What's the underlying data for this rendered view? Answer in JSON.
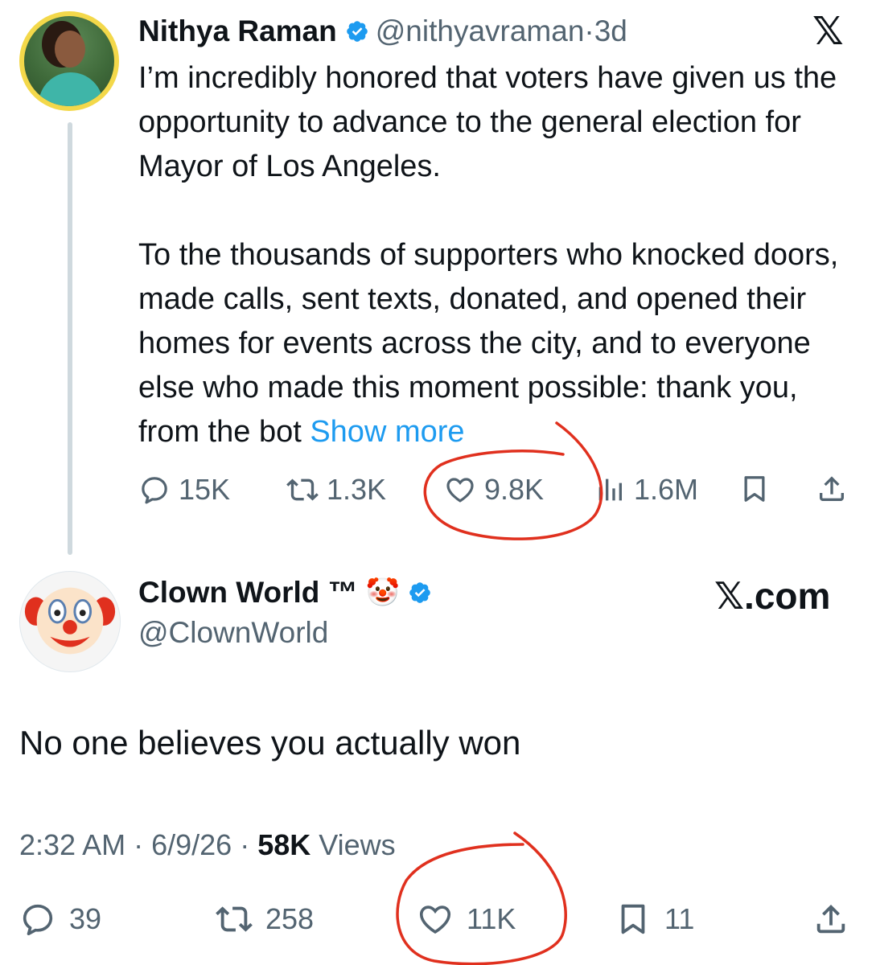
{
  "tweet1": {
    "name": "Nithya Raman",
    "handle": "@nithyavraman",
    "separator": " · ",
    "time": "3d",
    "platform_logo": "𝕏",
    "body": "I’m incredibly honored that voters have given us the opportunity to advance to the general election for Mayor of Los Angeles.\n\nTo the thousands of supporters who knocked doors, made calls, sent texts, donated, and opened their homes for events across the city, and to everyone else who made this moment possible: thank you, from the bot ",
    "show_more": "Show more",
    "replies": "15K",
    "reposts": "1.3K",
    "likes": "9.8K",
    "views": "1.6M"
  },
  "tweet2": {
    "name": "Clown World ™",
    "name_emoji": "🤡",
    "handle": "@ClownWorld",
    "site": "𝕏.com",
    "body": "No one believes you actually won",
    "time": "2:32 AM",
    "date": "6/9/26",
    "views_count": "58K",
    "views_label": "Views",
    "replies": "39",
    "reposts": "258",
    "likes": "11K",
    "bookmarks": "11"
  },
  "colors": {
    "text": "#0f1419",
    "secondary": "#536471",
    "link": "#1d9bf0",
    "verified": "#1d9bf0",
    "annotation": "#e0301e"
  },
  "icons": [
    "verified-badge-icon",
    "reply-icon",
    "repost-icon",
    "like-icon",
    "views-icon",
    "bookmark-icon",
    "share-icon",
    "x-logo-icon"
  ]
}
